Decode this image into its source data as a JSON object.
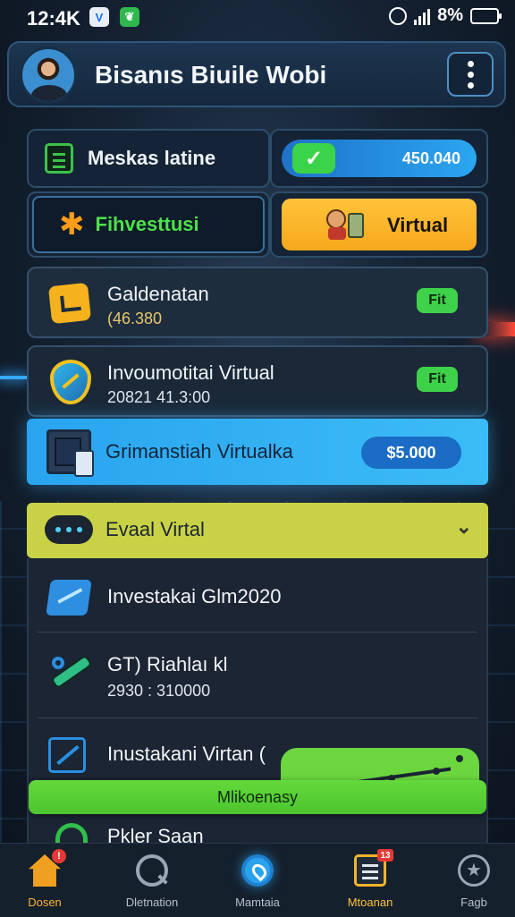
{
  "status_bar": {
    "time": "12:4K",
    "battery_text": "8%",
    "app_a": "V",
    "app_b": "",
    "battery_level": 0.9
  },
  "header": {
    "title": "Bisanıs Biuile Wobi"
  },
  "tiles": {
    "tile1_label": "Meskas latine",
    "tile2_value": "450.040",
    "tile2_check": "✓",
    "tile3_label": "Fihvesttusi",
    "tile4_label": "Virtual"
  },
  "cards": [
    {
      "title": "Galdenatan",
      "sub": "(46.380",
      "badge": "Fit"
    },
    {
      "title": "Invoumotitai Virtual",
      "sub": "20821 41.3:00",
      "badge": "Fit"
    }
  ],
  "highlight": {
    "title": "Grimanstiah Virtualka",
    "price": "$5.000"
  },
  "accordion": {
    "title": "Evaal Virtal",
    "chevron": "⌄"
  },
  "list": [
    {
      "title": "Investakai Glm2020",
      "sub": ""
    },
    {
      "title": "GT) Riahlaı kl",
      "sub": "2930 : 310000"
    },
    {
      "title": "Inustakani Virtan (",
      "sub": ""
    },
    {
      "title": "Pkler Saan",
      "sub": ""
    }
  ],
  "green_bar": {
    "label": "Mlikoenasy"
  },
  "bottom_nav": [
    {
      "label": "Dosen",
      "icon": "home-icon",
      "badge": "!"
    },
    {
      "label": "Dletnation",
      "icon": "search-icon"
    },
    {
      "label": "Mamtaia",
      "icon": "map-icon"
    },
    {
      "label": "Mtoanan",
      "icon": "document-icon",
      "badge": "13"
    },
    {
      "label": "Fagb",
      "icon": "star-icon"
    }
  ],
  "colors": {
    "accent_green": "#3ec24a",
    "accent_blue": "#2ba6ef",
    "accent_yellow": "#f7a81c",
    "accordion": "#c9d246"
  }
}
